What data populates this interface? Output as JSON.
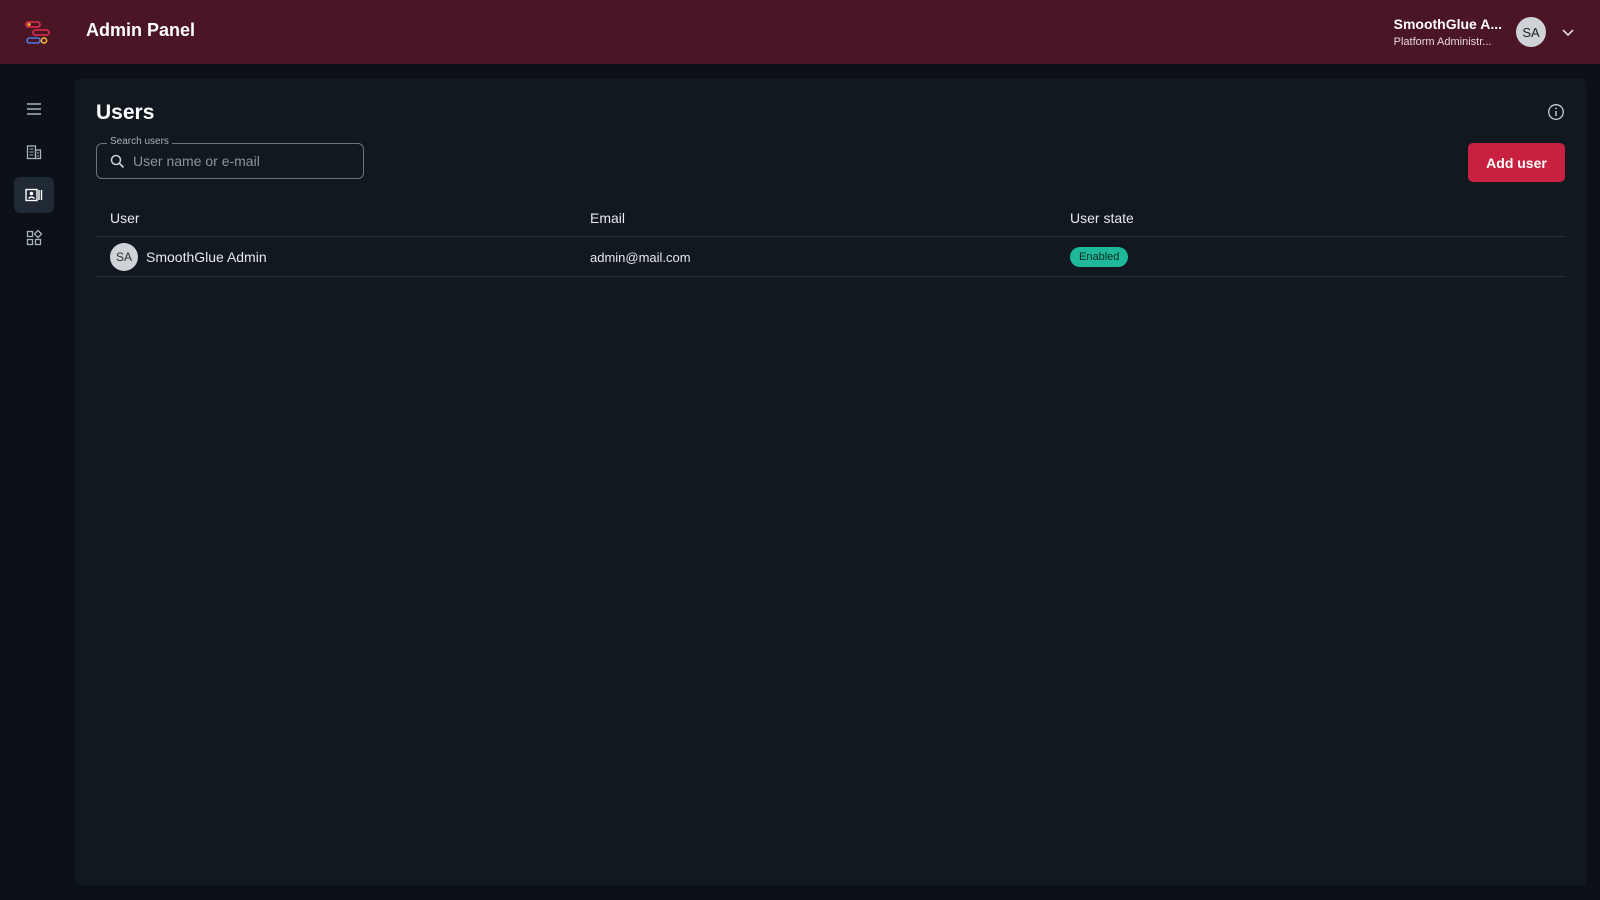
{
  "header": {
    "app_title": "Admin Panel",
    "user_name": "SmoothGlue A...",
    "user_role": "Platform Administr...",
    "avatar_initials": "SA"
  },
  "sidebar": {
    "items": [
      {
        "icon": "menu-icon",
        "active": false
      },
      {
        "icon": "building-icon",
        "active": false
      },
      {
        "icon": "users-card-icon",
        "active": true
      },
      {
        "icon": "apps-grid-icon",
        "active": false
      }
    ]
  },
  "main": {
    "title": "Users",
    "search": {
      "label": "Search users",
      "placeholder": "User name or e-mail",
      "value": ""
    },
    "add_button": "Add user",
    "table": {
      "headers": [
        "User",
        "Email",
        "User state"
      ],
      "rows": [
        {
          "initials": "SA",
          "name": "SmoothGlue Admin",
          "email": "admin@mail.com",
          "state": "Enabled"
        }
      ]
    }
  },
  "colors": {
    "header_bg": "#4a1525",
    "accent_button": "#c8203f",
    "badge_enabled": "#1fb89a"
  }
}
